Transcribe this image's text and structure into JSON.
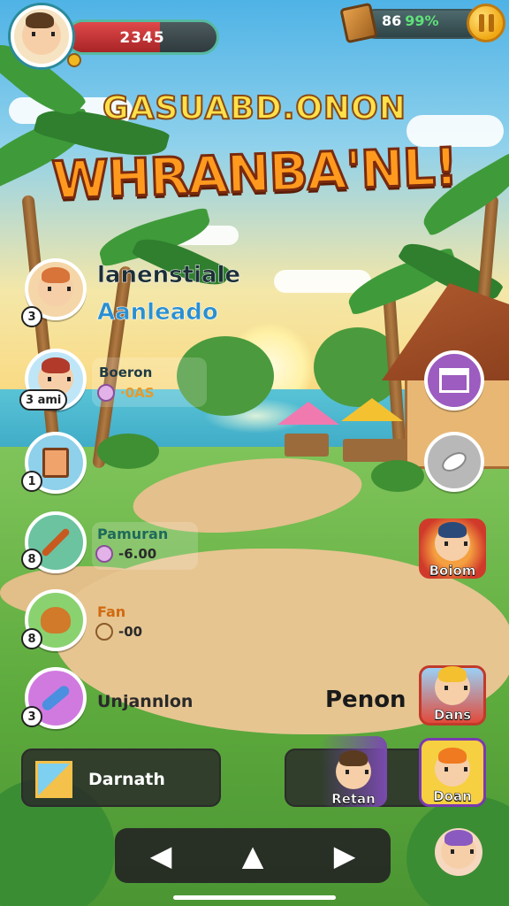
{
  "player": {
    "score": "2345",
    "health_fraction": 0.62
  },
  "resources": {
    "count": "86",
    "percent": "99%"
  },
  "title": {
    "subtitle": "GASUABD.ONON",
    "main": "WHRANBA'NL!"
  },
  "quests": [
    {
      "count": "3",
      "name": "lanenstiale",
      "name2": "Aanleado",
      "icon": "cowboy-face-icon",
      "color": "#e98a3a"
    },
    {
      "count": "3 ami",
      "name": "Boeron",
      "value": "·0AS",
      "icon": "girl-face-icon",
      "color": "#4fb4dd"
    },
    {
      "count": "1",
      "icon": "notebook-icon",
      "color": "#3a9ec8"
    },
    {
      "count": "8",
      "name": "Pamuran",
      "value": "-6.00",
      "icon": "arrow-icon",
      "color": "#3ea27a"
    },
    {
      "count": "8",
      "name": "Fan",
      "value": "-00",
      "icon": "bread-icon",
      "color": "#5cae4a"
    },
    {
      "count": "3",
      "name": "Unjannlon",
      "icon": "brush-icon",
      "color": "#b85ad0"
    }
  ],
  "side": {
    "building_icon": "building-icon",
    "chicken_icon": "chicken-leg-icon",
    "villager_label": "Boiom",
    "right_label": "Penon",
    "char_top_label": "Dans",
    "char_mid_left_label": "Retan",
    "char_mid_right_label": "Doan"
  },
  "bottom": {
    "action_label": "Darnath"
  },
  "nav": {
    "left": "◀",
    "up": "▲",
    "right": "▶"
  },
  "colors": {
    "accent": "#f0a712",
    "panel": "#2b2b2b",
    "health": "#e0494a"
  }
}
